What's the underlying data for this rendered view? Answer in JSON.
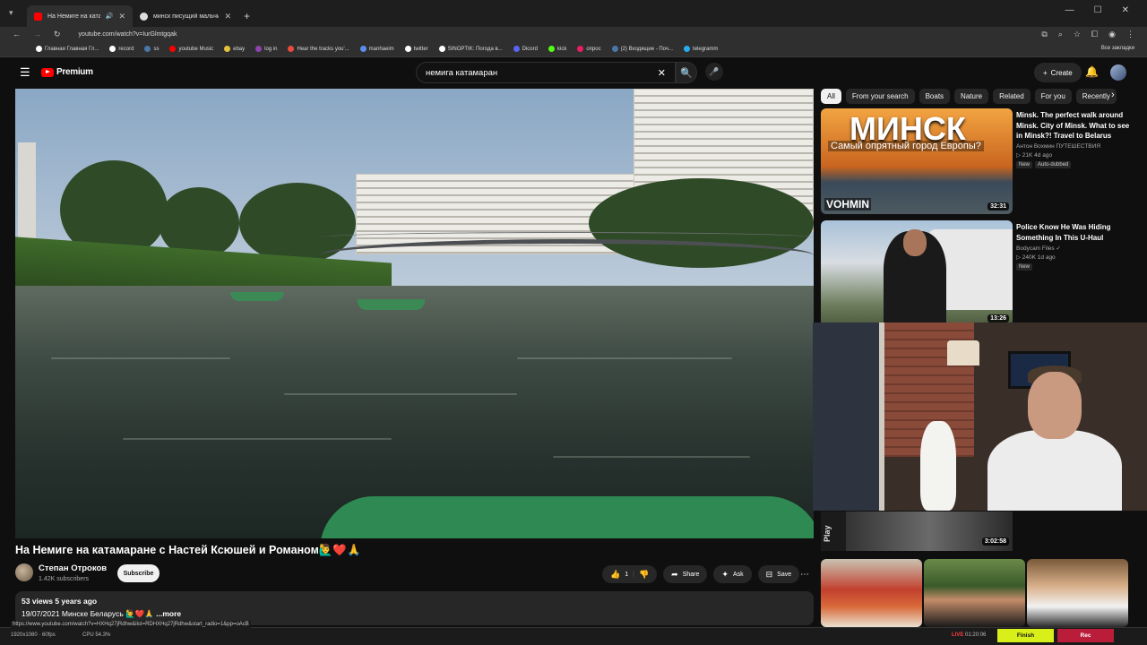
{
  "browser": {
    "tabs": [
      {
        "title": "На Немиге на катамаране",
        "favicon_color": "#ff0000",
        "active": true
      },
      {
        "title": "минск писущий мальчик - G",
        "favicon_color": "#dddddd",
        "active": false
      }
    ],
    "url": "youtube.com/watch?v=IurGlmtgqak",
    "bookmarks": [
      {
        "label": "Главная Главная Гл...",
        "color": "#ffffff"
      },
      {
        "label": "record",
        "color": "#ffffff"
      },
      {
        "label": "ss",
        "color": "#4a76a8"
      },
      {
        "label": "youtube Music",
        "color": "#ff0000"
      },
      {
        "label": "ebay",
        "color": "#e8c13a"
      },
      {
        "label": "log in",
        "color": "#8e44ad"
      },
      {
        "label": "Hear the tracks you'...",
        "color": "#e74c3c"
      },
      {
        "label": "manhaeim",
        "color": "#5b8def"
      },
      {
        "label": "twitter",
        "color": "#ffffff"
      },
      {
        "label": "SINOPTIK: Погода в...",
        "color": "#ffffff"
      },
      {
        "label": "Dicord",
        "color": "#5865f2"
      },
      {
        "label": "kick",
        "color": "#53fc18"
      },
      {
        "label": "опрос",
        "color": "#e91e63"
      },
      {
        "label": "(2) Входящие - Поч...",
        "color": "#4a76a8"
      },
      {
        "label": "telegramm",
        "color": "#2aabee"
      }
    ],
    "bookmarks_all": "Все закладки"
  },
  "youtube": {
    "logo_text": "Premium",
    "search_value": "немига катамаран",
    "create_label": "Create"
  },
  "video": {
    "title": "На Немиге на катамаране с Настей Ксюшей и Романом🙋‍♂️❤️🙏",
    "channel": "Степан Отроков",
    "subscribers": "1.42K subscribers",
    "subscribe_label": "Subscribe",
    "likes": "1",
    "share_label": "Share",
    "ask_label": "Ask",
    "save_label": "Save",
    "views_age": "53 views  5 years ago",
    "description": "19/07/2021 Минске Беларусь 🙋‍♂️❤️🙏",
    "more_label": "...more"
  },
  "chips": [
    "All",
    "From your search",
    "Boats",
    "Nature",
    "Related",
    "For you",
    "Recently"
  ],
  "recommendations": [
    {
      "title": "Minsk. The perfect walk around Minsk. City of Minsk. What to see in Minsk?! Travel to Belarus",
      "channel": "Антон Вохмин ПУТЕШЕСТВИЯ",
      "meta": "▷ 21K  4d ago",
      "badges": [
        "New",
        "Auto-dubbed"
      ],
      "duration": "32:31",
      "thumb_title": "МИНСК",
      "thumb_sub": "Самый опрятный город Европы?",
      "thumb_brand": "VOHMIN"
    },
    {
      "title": "Police Know He Was Hiding Something In This U-Haul",
      "channel": "Bodycam Files ✓",
      "meta": "▷ 240K  1d ago",
      "badges": [
        "New"
      ],
      "duration": "13:26"
    }
  ],
  "playlist": {
    "duration": "3:02:58",
    "label": "Play"
  },
  "statusbar": {
    "hover_url": "https://www.youtube.com/watch?v=HXHq27jRdhw&list=RDHXHq27jRdhw&start_radio=1&pp=oAcB",
    "resolution": "1920x1080 · 60fps",
    "cpu": "CPU 54.3%",
    "live_label": "LIVE",
    "live_time": "01:20:06",
    "finish_label": "Finish",
    "rec_label": "Rec"
  }
}
